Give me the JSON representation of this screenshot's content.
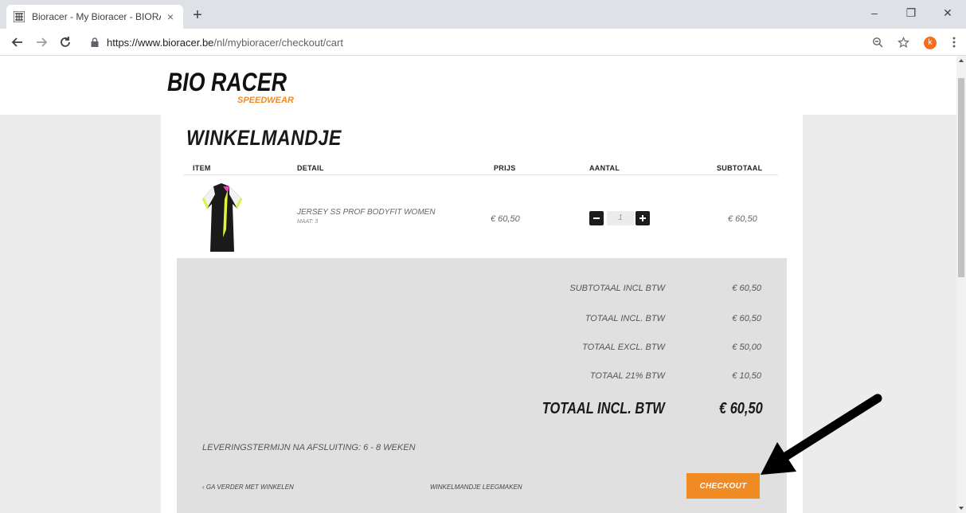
{
  "browser": {
    "tab_title": "Bioracer - My Bioracer - BIORACE",
    "tab_close": "×",
    "new_tab": "+",
    "url_host": "https://www.bioracer.be",
    "url_path": "/nl/mybioracer/checkout/cart",
    "avatar_letter": "k",
    "minimize": "–",
    "restore": "❐",
    "close": "✕"
  },
  "site": {
    "logo_text": "BIO RACER",
    "logo_sub": "SPEEDWEAR"
  },
  "cart": {
    "title": "WINKELMANDJE",
    "columns": [
      "ITEM",
      "DETAIL",
      "PRIJS",
      "AANTAL",
      "SUBTOTAAL"
    ],
    "item": {
      "name": "JERSEY SS PROF BODYFIT WOMEN",
      "size": "MAAT: 3",
      "price": "€ 60,50",
      "quantity": "1",
      "subtotal": "€ 60,50"
    },
    "totals": [
      {
        "label": "SUBTOTAAL INCL BTW",
        "value": "€ 60,50"
      },
      {
        "label": "TOTAAL INCL. BTW",
        "value": "€ 60,50"
      },
      {
        "label": "TOTAAL EXCL. BTW",
        "value": "€ 50,00"
      },
      {
        "label": "TOTAAL 21% BTW",
        "value": "€ 10,50"
      }
    ],
    "grand_total": {
      "label": "TOTAAL INCL. BTW",
      "value": "€ 60,50"
    },
    "delivery": "LEVERINGSTERMIJN NA AFSLUITING: 6 - 8 WEKEN",
    "continue_label": "‹ GA VERDER MET WINKELEN",
    "empty_label": "WINKELMANDJE LEEGMAKEN",
    "checkout_label": "CHECKOUT"
  },
  "colors": {
    "accent_orange": "#f08a22",
    "page_bg": "#ececec",
    "panel_bg": "#e0e0e0"
  },
  "icons": [
    "favicon-icon",
    "back-icon",
    "forward-icon",
    "reload-icon",
    "lock-icon",
    "zoom-icon",
    "star-icon",
    "menu-icon",
    "minus-icon",
    "plus-icon",
    "arrow-annotation-icon"
  ]
}
